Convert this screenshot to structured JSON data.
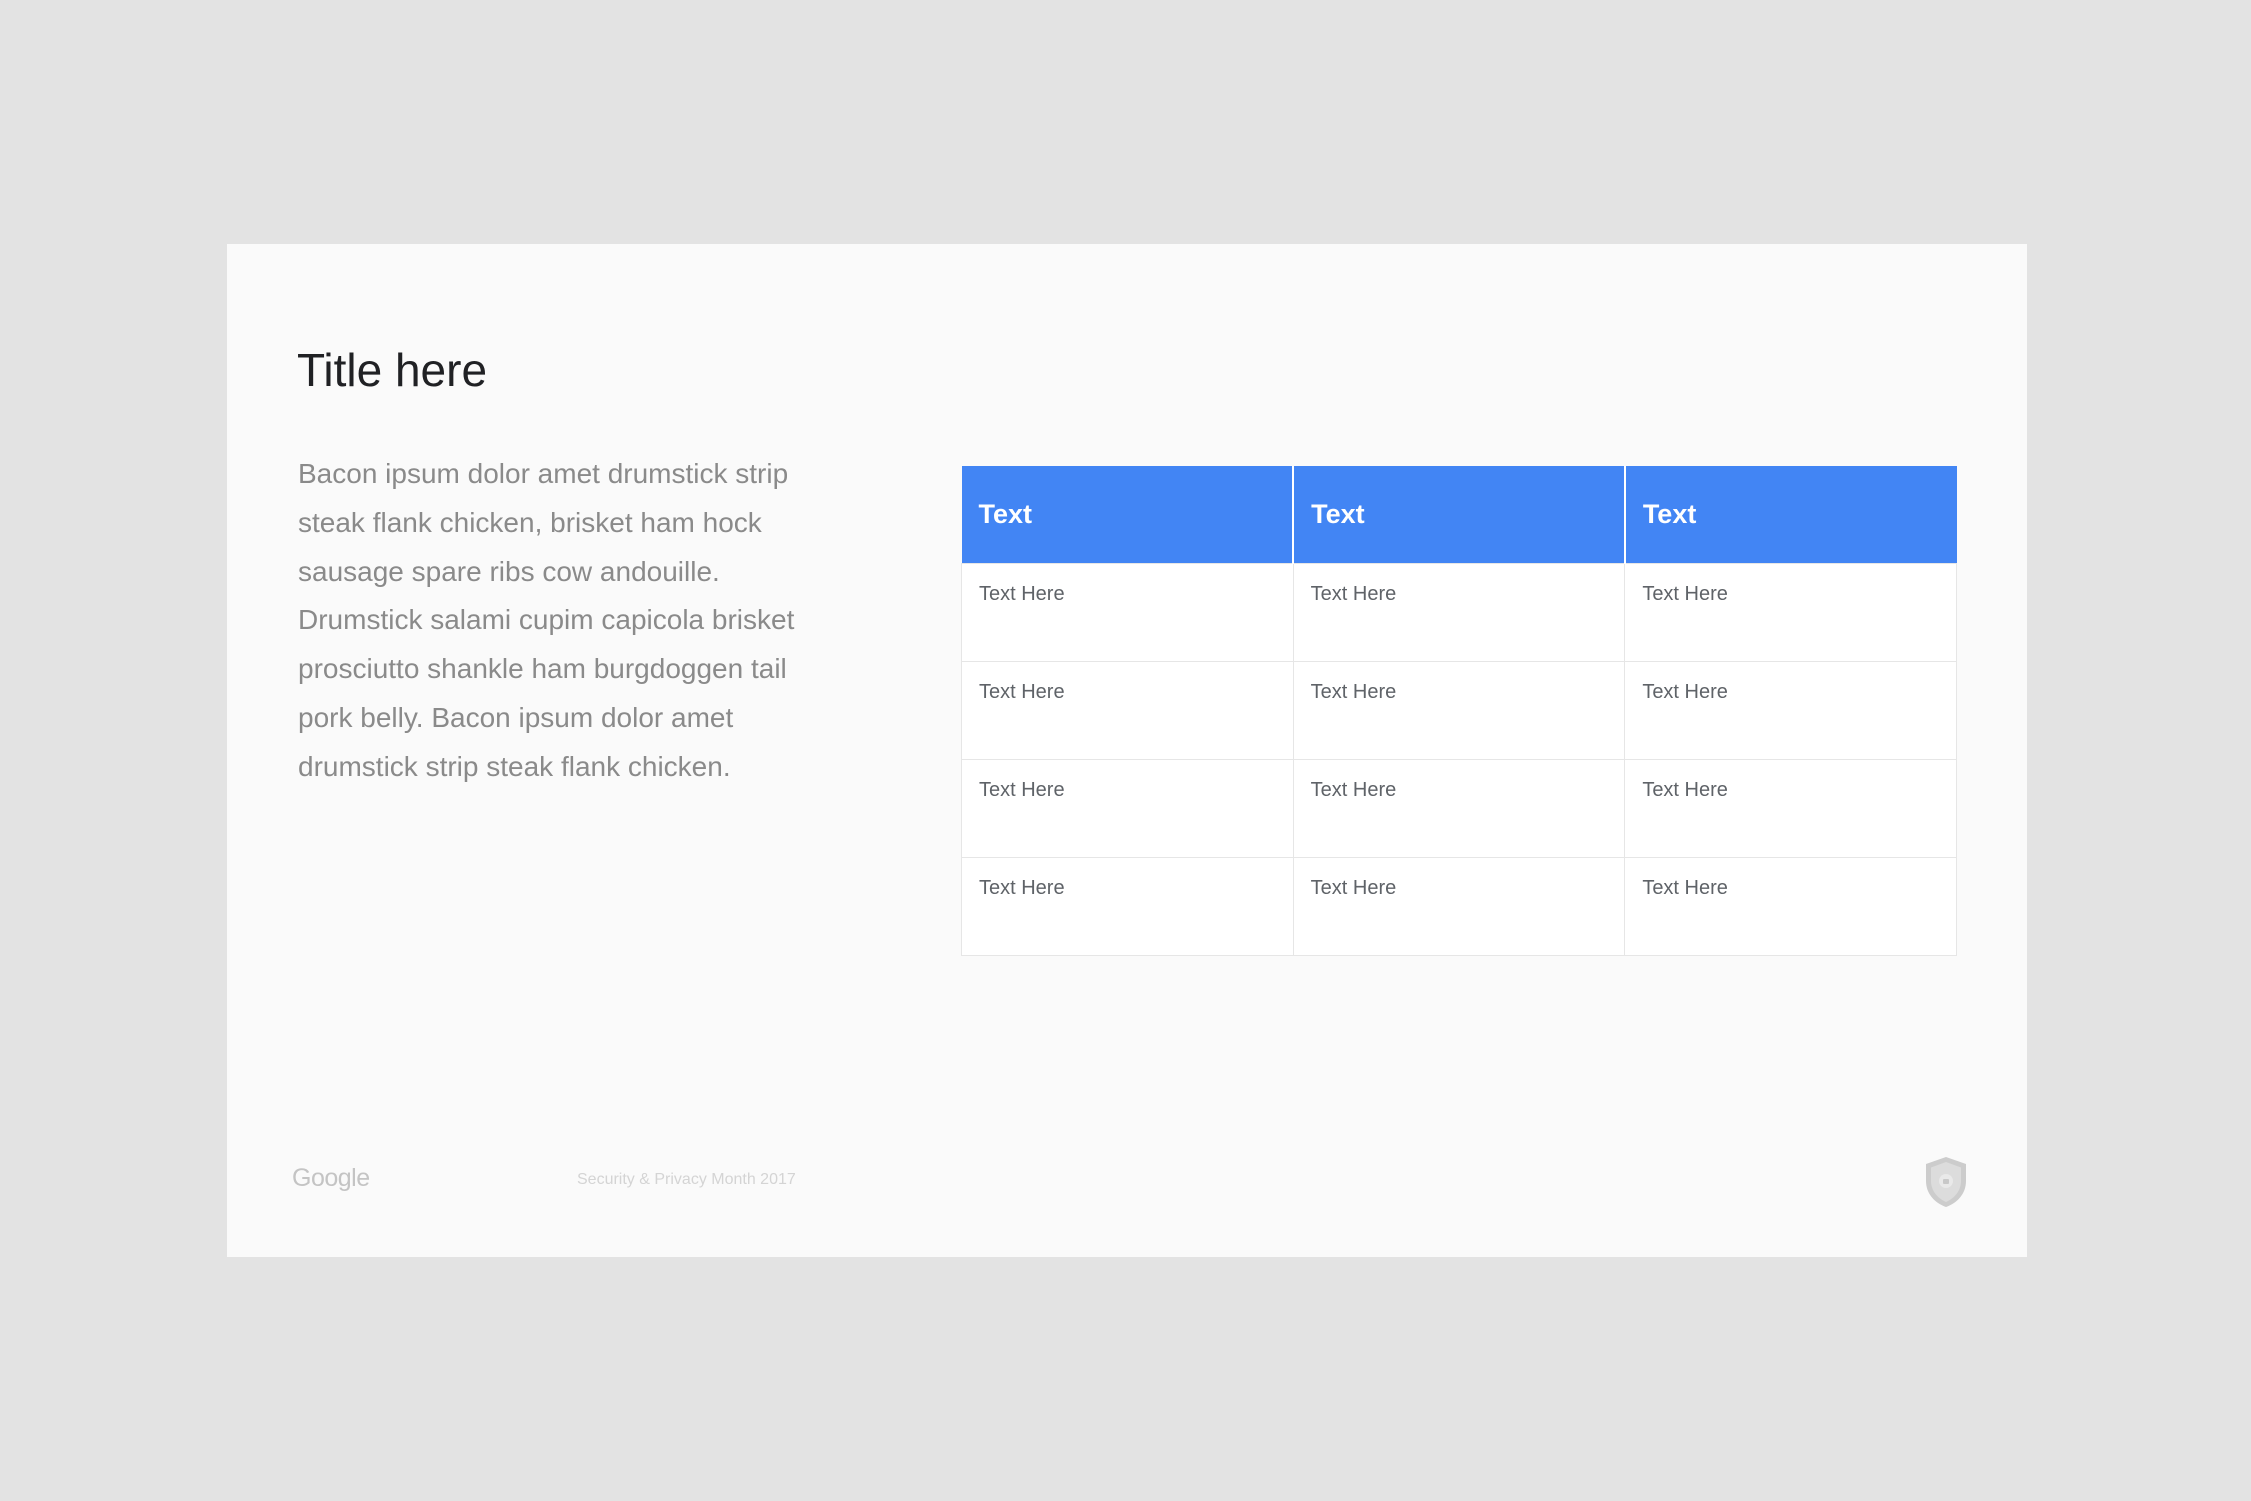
{
  "slide": {
    "title": "Title here",
    "body": "Bacon ipsum dolor amet drumstick strip steak flank chicken, brisket ham hock sausage spare ribs cow andouille. Drumstick salami cupim capicola brisket prosciutto shankle ham burgdoggen tail pork belly. Bacon ipsum dolor amet drumstick strip steak flank chicken."
  },
  "table": {
    "headers": [
      "Text",
      "Text",
      "Text"
    ],
    "rows": [
      [
        "Text Here",
        "Text Here",
        "Text Here"
      ],
      [
        "Text Here",
        "Text Here",
        "Text Here"
      ],
      [
        "Text Here",
        "Text Here",
        "Text Here"
      ],
      [
        "Text Here",
        "Text Here",
        "Text Here"
      ]
    ]
  },
  "footer": {
    "logo": "Google",
    "caption": "Security & Privacy Month 2017",
    "badge_icon": "shield-lock-icon"
  },
  "colors": {
    "header": "#4285f4",
    "background": "#e3e3e3",
    "slide": "#fafafa"
  }
}
